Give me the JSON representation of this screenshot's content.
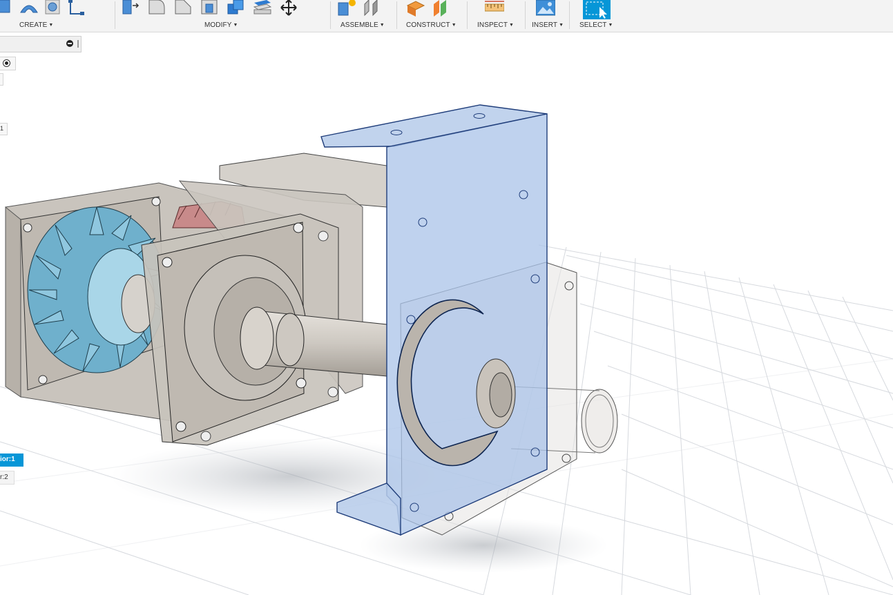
{
  "toolbar": {
    "groups": [
      {
        "label": "CREATE"
      },
      {
        "label": "MODIFY"
      },
      {
        "label": "ASSEMBLE"
      },
      {
        "label": "CONSTRUCT"
      },
      {
        "label": "INSPECT"
      },
      {
        "label": "INSERT"
      },
      {
        "label": "SELECT"
      }
    ]
  },
  "browser": {
    "occurrence_selected": "ior:1",
    "occurrence_next": "r:2",
    "row_label": "1"
  },
  "colors": {
    "accent": "#0696d7",
    "selection_fill": "#a9c3e8",
    "grid": "#d6d9de"
  }
}
